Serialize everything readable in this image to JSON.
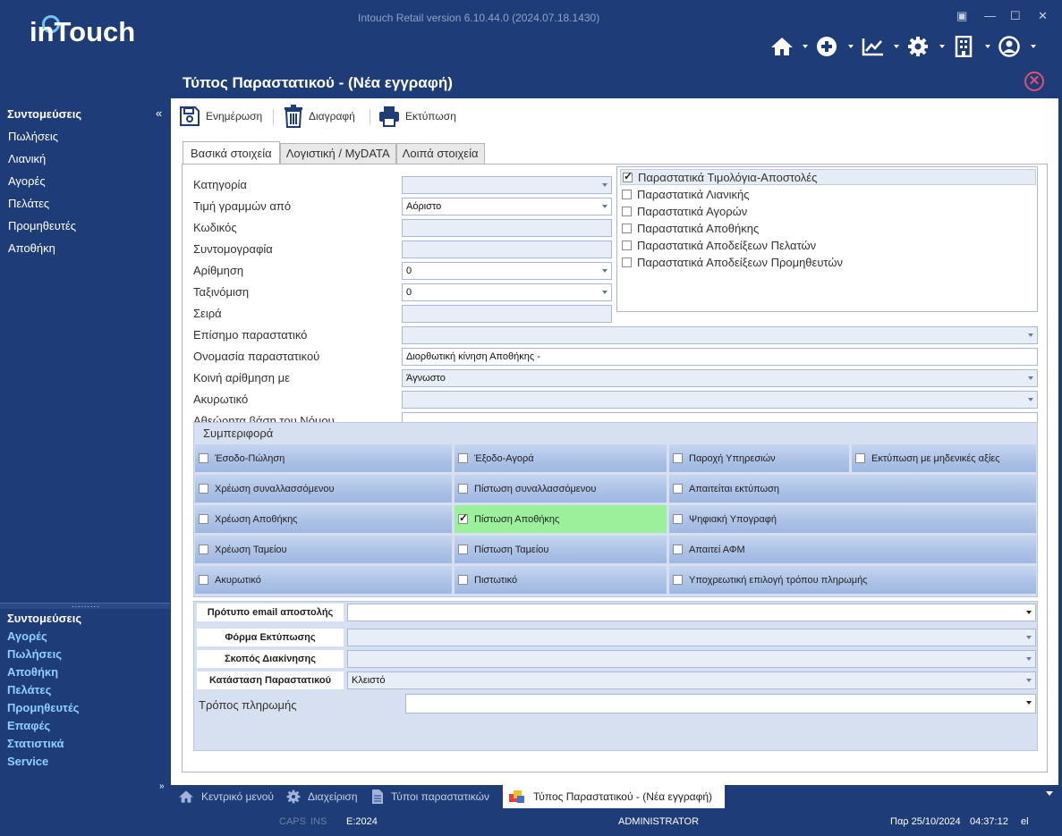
{
  "app": {
    "logo": "inTouch",
    "window_title": "Intouch Retail version 6.10.44.0 (2024.07.18.1430)"
  },
  "sidebar": {
    "heading": "Συντομεύσεις",
    "items": [
      "Πωλήσεις",
      "Λιανική",
      "Αγορές",
      "Πελάτες",
      "Προμηθευτές",
      "Αποθήκη"
    ],
    "bottom_heading": "Συντομεύσεις",
    "bottom_items": [
      "Αγορές",
      "Πωλήσεις",
      "Αποθήκη",
      "Πελάτες",
      "Προμηθευτές",
      "Επαφές",
      "Στατιστικά",
      "Service"
    ]
  },
  "panel": {
    "title": "Τύπος Παραστατικού - (Νέα εγγραφή)"
  },
  "toolbar": {
    "update_label": "Ενημέρωση",
    "delete_label": "Διαγραφή",
    "print_label": "Εκτύπωση"
  },
  "tabs": [
    "Βασικά στοιχεία",
    "Λογιστική / MyDATA",
    "Λοιπά στοιχεία"
  ],
  "form": {
    "labels": [
      "Κατηγορία",
      "Τιμή γραμμών από",
      "Κωδικός",
      "Συντομογραφία",
      "Αρίθμηση",
      "Ταξινόμιση",
      "Σειρά",
      "Επίσημο παραστατικό",
      "Ονομασία παραστατικού",
      "Κοινή αρίθμηση με",
      "Ακυρωτικό",
      "Αθεώρητα βάση του Νόμου"
    ],
    "price_from": "Αόριστο",
    "numbering": "0",
    "sorting": "0",
    "doc_name": "Διορθωτική κίνηση Αποθήκης -",
    "common_numbering": "Άγνωστο"
  },
  "checklist": [
    {
      "label": "Παραστατικά Τιμολόγια-Αποστολές",
      "checked": true
    },
    {
      "label": "Παραστατικά Λιανικής",
      "checked": false
    },
    {
      "label": "Παραστατικά Αγορών",
      "checked": false
    },
    {
      "label": "Παραστατικά Αποθήκης",
      "checked": false
    },
    {
      "label": "Παραστατικά Αποδείξεων Πελατών",
      "checked": false
    },
    {
      "label": "Παραστατικά Αποδείξεων Προμηθευτών",
      "checked": false
    }
  ],
  "behaviour": {
    "title": "Συμπεριφορά",
    "col1": [
      "Έσοδο-Πώληση",
      "Χρέωση συναλλασσόμενου",
      "Χρέωση Αποθήκης",
      "Χρέωση Ταμείου",
      "Ακυρωτικό"
    ],
    "col2": [
      "Έξοδο-Αγορά",
      "Πίστωση συναλλασσόμενου",
      "Πίστωση  Αποθήκης",
      "Πίστωση Ταμείου",
      "Πιστωτικό"
    ],
    "col3": [
      "Παροχή Υπηρεσιών",
      "Απαιτείται εκτύπωση",
      "Ψηφιακή Υπογραφή",
      "Απαιτεί ΑΦΜ",
      "Υποχρεωτική επιλογή τρόπου πληρωμής"
    ],
    "col4": [
      "Εκτύπωση με μηδενικές αξίες"
    ],
    "checked": "Πίστωση  Αποθήκης",
    "checked_color": "#9cf09c"
  },
  "lower": {
    "email_label": "Πρότυπο email αποστολής",
    "print_form_label": "Φόρμα Εκτύπωσης",
    "purpose_label": "Σκοπός Διακίνησης",
    "status_label": "Κατάσταση Παραστατικού",
    "status_value": "Κλειστό",
    "payment_label": "Τρόπος πληρωμής"
  },
  "taskbar": [
    "Κεντρικό μενού",
    "Διαχείριση",
    "Τύποι παραστατικών",
    "Τύπος Παραστατικού - (Νέα εγγραφή)"
  ],
  "status": {
    "caps": "CAPS",
    "ins": "INS",
    "year": "E:2024",
    "user": "ADMINISTRATOR",
    "date": "Παρ 25/10/2024",
    "time": "04:37:12",
    "lang": "el"
  },
  "colors": {
    "navy": "#1e3c78",
    "close_accent": "#e05070"
  },
  "icons": [
    "home-icon",
    "plus-icon",
    "chart-icon",
    "gear-icon",
    "building-icon",
    "user-icon",
    "save-icon",
    "trash-icon",
    "printer-icon",
    "close-icon"
  ]
}
